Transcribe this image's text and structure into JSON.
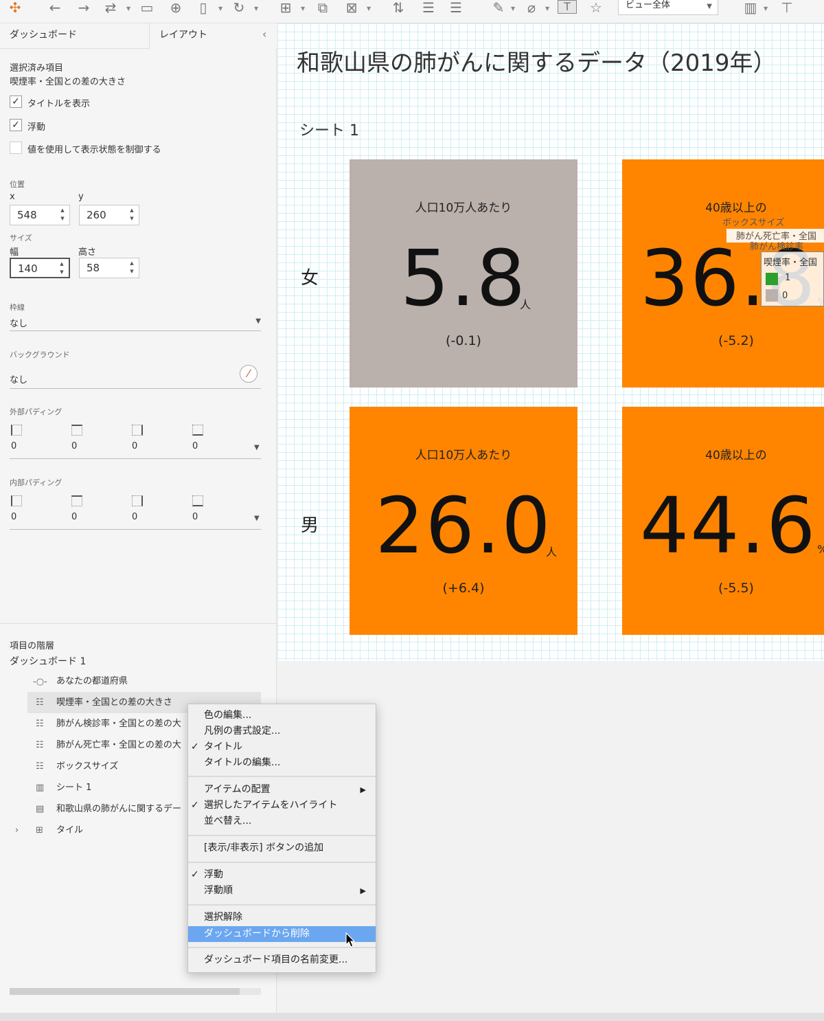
{
  "toolbar": {
    "icons": [
      "tableau-logo-icon",
      "back-icon",
      "forward-icon",
      "redo-icon",
      "save-icon",
      "new-datasource-icon",
      "pause-icon",
      "refresh-icon",
      "new-sheet-icon",
      "duplicate-icon",
      "clear-icon",
      "swap-icon",
      "sort-asc-icon",
      "sort-desc-icon",
      "highlight-icon",
      "attach-icon",
      "text-icon",
      "pin-icon",
      "chart-icon",
      "presentation-icon"
    ],
    "view_select": "ビュー全体"
  },
  "panel": {
    "tab_dashboard": "ダッシュボード",
    "tab_layout": "レイアウト",
    "selected_heading": "選択済み項目",
    "selected_name": "喫煙率・全国との差の大きさ",
    "show_title": "タイトルを表示",
    "floating": "浮動",
    "use_value": "値を使用して表示状態を制御する",
    "position_label": "位置",
    "x_label": "x",
    "y_label": "y",
    "x_value": "548",
    "y_value": "260",
    "size_label": "サイズ",
    "width_label": "幅",
    "height_label": "高さ",
    "width_value": "140",
    "height_value": "58",
    "border_label": "枠線",
    "border_value": "なし",
    "background_label": "バックグラウンド",
    "background_value": "なし",
    "outer_padding_label": "外部パディング",
    "outer_padding": [
      "0",
      "0",
      "0",
      "0"
    ],
    "inner_padding_label": "内部パディング",
    "inner_padding": [
      "0",
      "0",
      "0",
      "0"
    ],
    "hierarchy_label": "項目の階層",
    "dashboard_name": "ダッシュボード 1",
    "items": [
      "あなたの都道府県",
      "喫煙率・全国との差の大きさ",
      "肺がん検診率・全国との差の大",
      "肺がん死亡率・全国との差の大",
      "ボックスサイズ",
      "シート 1",
      "和歌山県の肺がんに関するデー",
      "タイル"
    ]
  },
  "dashboard": {
    "title": "和歌山県の肺がんに関するデータ（2019年）",
    "sheet_title": "シート 1",
    "row_female": "女",
    "row_male": "男",
    "boxes": [
      {
        "title": "人口10万人あたり",
        "value": "5.8",
        "unit": "人",
        "diff": "(-0.1)",
        "color": "#bab0ac"
      },
      {
        "title": "40歳以上の",
        "value": "36.8",
        "unit": "%",
        "diff": "(-5.2)",
        "color": "#ff8500"
      },
      {
        "title": "人口10万人あたり",
        "value": "26.0",
        "unit": "人",
        "diff": "(+6.4)",
        "color": "#ff8500"
      },
      {
        "title": "40歳以上の",
        "value": "44.6",
        "unit": "%",
        "diff": "(-5.5)",
        "color": "#ff8500"
      }
    ],
    "legend_overlay": {
      "box_size": "ボックスサイズ",
      "death_rate": "肺がん死亡率・全国",
      "screening": "肺がん検診率",
      "smoking": "喫煙率・全国",
      "val1": "1",
      "val0": "0"
    }
  },
  "context_menu": {
    "items": [
      {
        "label": "色の編集...",
        "checked": false
      },
      {
        "label": "凡例の書式設定...",
        "checked": false
      },
      {
        "label": "タイトル",
        "checked": true
      },
      {
        "label": "タイトルの編集...",
        "checked": false
      },
      {
        "label": "アイテムの配置",
        "checked": false,
        "submenu": true
      },
      {
        "label": "選択したアイテムをハイライト",
        "checked": true
      },
      {
        "label": "並べ替え...",
        "checked": false
      },
      {
        "label": "[表示/非表示] ボタンの追加",
        "checked": false
      },
      {
        "label": "浮動",
        "checked": true
      },
      {
        "label": "浮動順",
        "checked": false,
        "submenu": true
      },
      {
        "label": "選択解除",
        "checked": false
      },
      {
        "label": "ダッシュボードから削除",
        "checked": false,
        "highlighted": true
      },
      {
        "label": "ダッシュボード項目の名前変更...",
        "checked": false
      }
    ],
    "check": "✓",
    "arrow": "▶"
  }
}
